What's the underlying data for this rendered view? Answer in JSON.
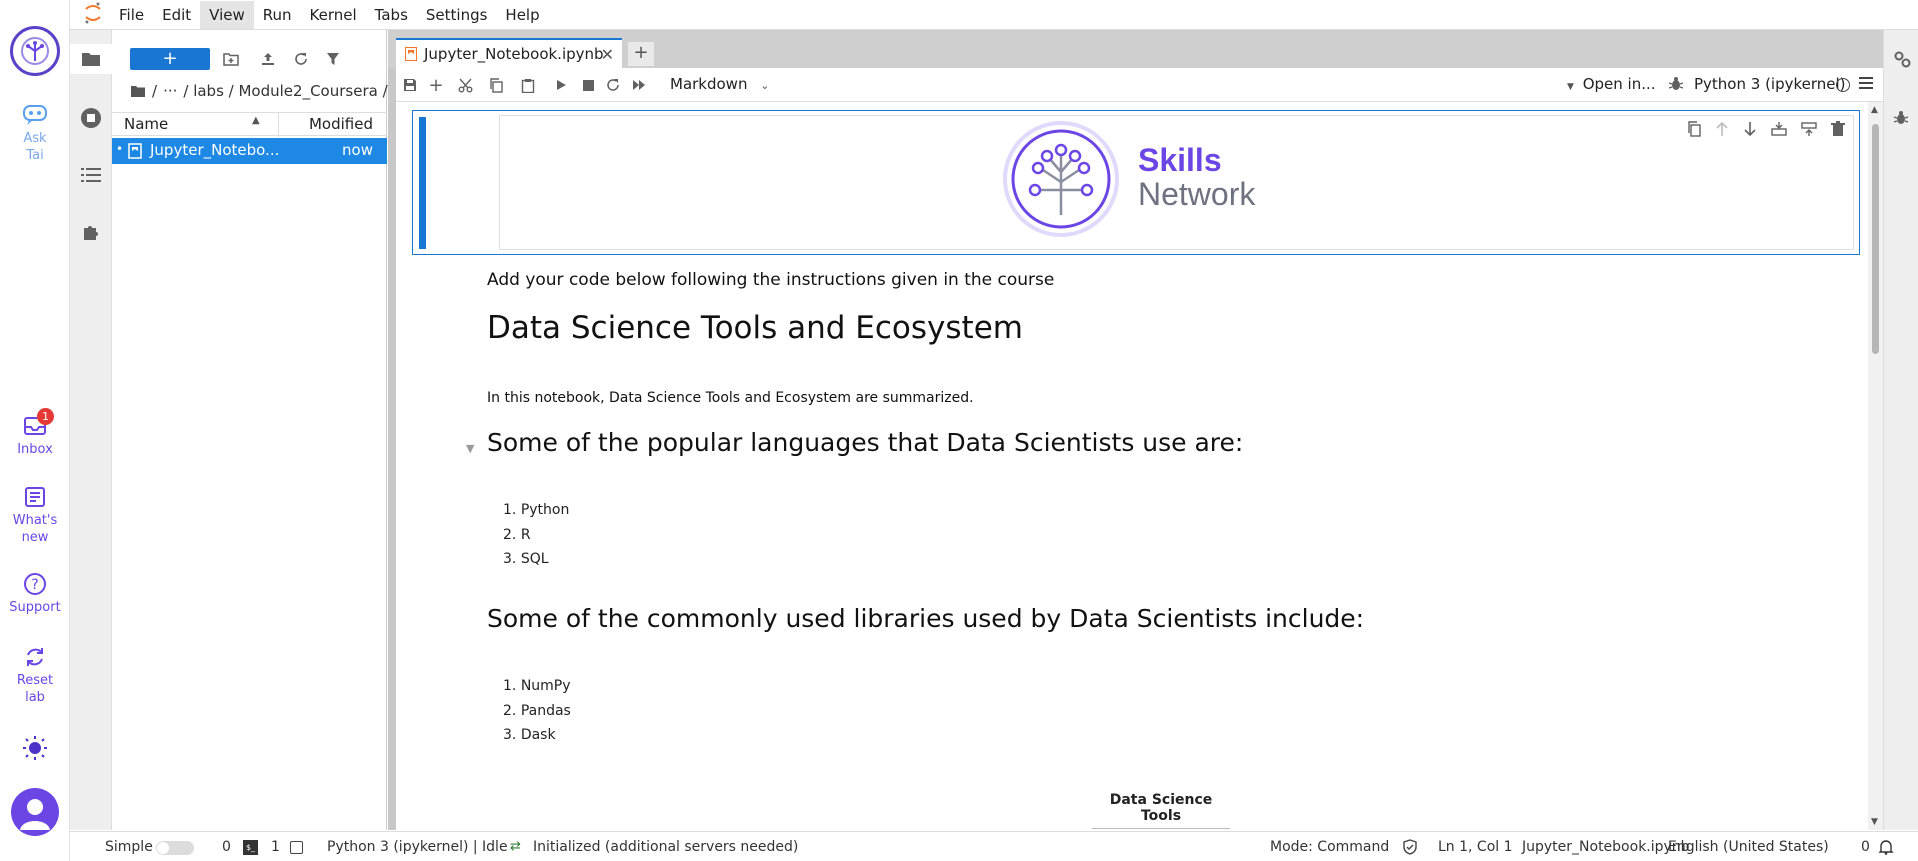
{
  "skills_sidebar": {
    "items": [
      {
        "label_line1": "Ask",
        "label_line2": "Tai",
        "icon": "chat-bot-icon"
      },
      {
        "label_line1": "Inbox",
        "label_line2": "",
        "icon": "inbox-icon",
        "badge": "1"
      },
      {
        "label_line1": "What's",
        "label_line2": "new",
        "icon": "news-icon"
      },
      {
        "label_line1": "Support",
        "label_line2": "",
        "icon": "help-icon"
      },
      {
        "label_line1": "Reset",
        "label_line2": "lab",
        "icon": "reset-icon"
      }
    ]
  },
  "menubar": {
    "items": [
      "File",
      "Edit",
      "View",
      "Run",
      "Kernel",
      "Tabs",
      "Settings",
      "Help"
    ],
    "active": "View"
  },
  "file_browser": {
    "new_label": "+",
    "breadcrumb": {
      "root": "/",
      "ellipsis": "···",
      "path": "/ labs / Module2_Coursera /"
    },
    "header": {
      "name": "Name",
      "modified": "Modified"
    },
    "files": [
      {
        "name": "Jupyter_Notebo...",
        "modified": "now"
      }
    ]
  },
  "tabs": {
    "doc_title": "Jupyter_Notebook.ipynb",
    "add": "+"
  },
  "nb_toolbar": {
    "cell_type": "Markdown",
    "open_in": "Open in...",
    "kernel": "Python 3 (ipykernel)"
  },
  "notebook": {
    "logo": {
      "line1": "Skills",
      "line2": "Network"
    },
    "intro": "Add your code below following the instructions given in the course",
    "title": "Data Science Tools and Ecosystem",
    "summary": "In this notebook, Data Science Tools and Ecosystem are summarized.",
    "languages_heading": "Some of the popular languages that Data Scientists use are:",
    "languages": [
      "Python",
      "R",
      "SQL"
    ],
    "libraries_heading": "Some of the commonly used libraries used by Data Scientists include:",
    "libraries": [
      "NumPy",
      "Pandas",
      "Dask"
    ],
    "table_header": "Data Science Tools"
  },
  "statusbar": {
    "mode_simple": "Simple",
    "terminals": "0",
    "kernels": "1",
    "kernel_status": "Python 3 (ipykernel) | Idle",
    "lsp": "Initialized (additional servers needed)",
    "mode": "Mode: Command",
    "position": "Ln 1, Col 1",
    "file": "Jupyter_Notebook.ipynb",
    "language": "English (United States)",
    "notifications": "0"
  },
  "colors": {
    "accent": "#1976d2",
    "skills_purple": "#6b46e5"
  }
}
